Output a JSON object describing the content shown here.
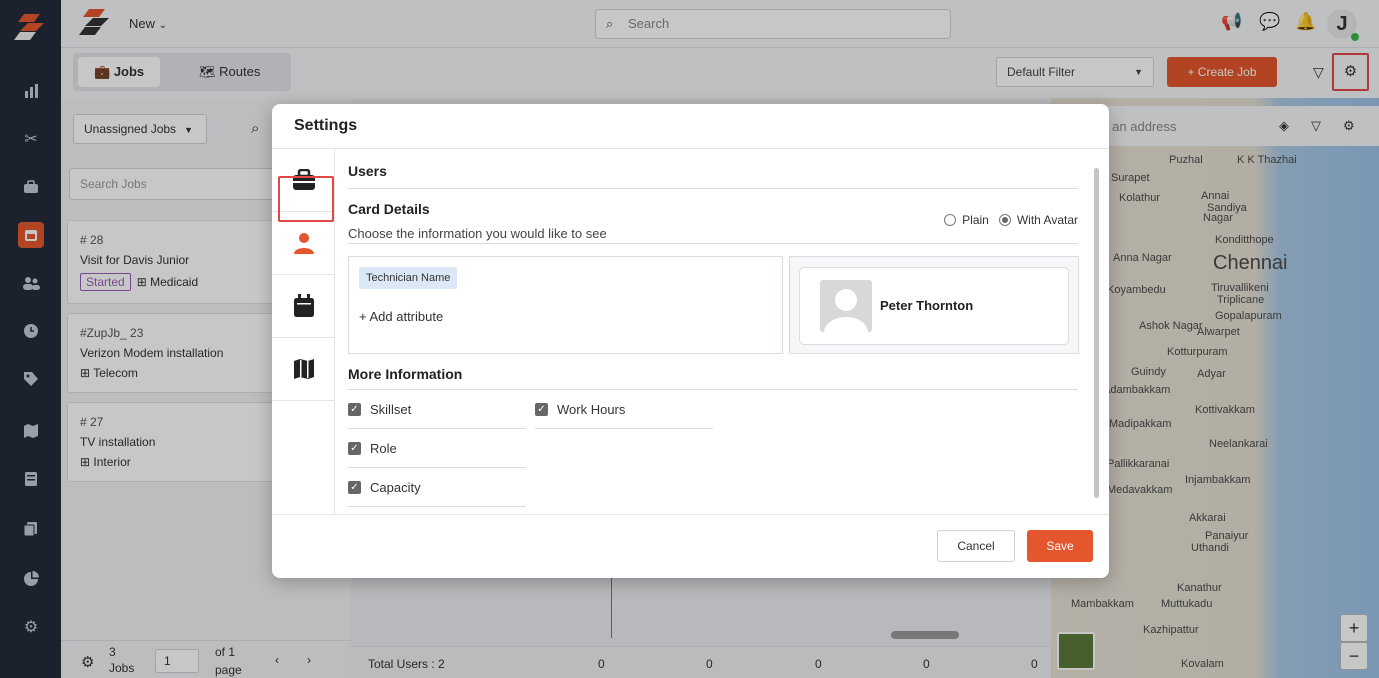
{
  "topbar": {
    "new_label": "New",
    "search_placeholder": "Search",
    "avatar_letter": "J"
  },
  "tabs": [
    {
      "label": "Jobs"
    },
    {
      "label": "Routes"
    }
  ],
  "toolbar": {
    "filter_value": "Default Filter",
    "create_job_label": "+ Create Job"
  },
  "leftpanel": {
    "filter_value": "Unassigned Jobs",
    "search_placeholder": "Search Jobs",
    "jobs": [
      {
        "id": "# 28",
        "title": "Visit for Davis Junior",
        "status": "Started",
        "tag": "Medicaid"
      },
      {
        "id": "#ZupJb_ 23",
        "title": "Verizon Modem installation",
        "tag": "Telecom"
      },
      {
        "id": "# 27",
        "title": "TV installation",
        "tag": "Interior"
      }
    ],
    "pager": {
      "count": "3",
      "count_label": "Jobs",
      "page_value": "1",
      "of_label": "of 1",
      "page_label": "page"
    }
  },
  "middle": {
    "total_users": "Total Users : 2",
    "col_values": [
      "0",
      "0",
      "0",
      "0",
      "0"
    ]
  },
  "map": {
    "address_placeholder": "er an address",
    "labels": [
      "Puzhal",
      "K K Thazhai",
      "Surapet",
      "Kolathur",
      "Annai",
      "Sandiya",
      "Nagar",
      "Konditthope",
      "Chennai",
      "Anna Nagar",
      "Koyambedu",
      "Tiruvallikeni",
      "Triplicane",
      "Gopalapuram",
      "Ashok Nagar",
      "Alwarpet",
      "Kotturpuram",
      "Guindy",
      "Adyar",
      "Adambakkam",
      "Kottivakkam",
      "Madipakkam",
      "Neelankarai",
      "Pallikkaranai",
      "Injambakkam",
      "Medavakkam",
      "Akkarai",
      "Panaiyur",
      "Uthandi",
      "Kanathur",
      "Mambakkam",
      "Muttukadu",
      "Kazhipattur",
      "Kovalam"
    ],
    "zoom_in": "+",
    "zoom_out": "−"
  },
  "modal": {
    "title": "Settings",
    "section_users": "Users",
    "card_details": "Card Details",
    "card_subtitle": "Choose the information you would like to see",
    "radio_plain": "Plain",
    "radio_avatar": "With Avatar",
    "chip_label": "Technician Name",
    "add_attribute": "+ Add attribute",
    "preview_name": "Peter Thornton",
    "more_info": "More Information",
    "checks": {
      "skillset": "Skillset",
      "work_hours": "Work Hours",
      "role": "Role",
      "capacity": "Capacity"
    },
    "cancel_label": "Cancel",
    "save_label": "Save"
  },
  "colors": {
    "accent": "#e4572e",
    "rail": "#232b3a",
    "highlight": "#e04848"
  }
}
